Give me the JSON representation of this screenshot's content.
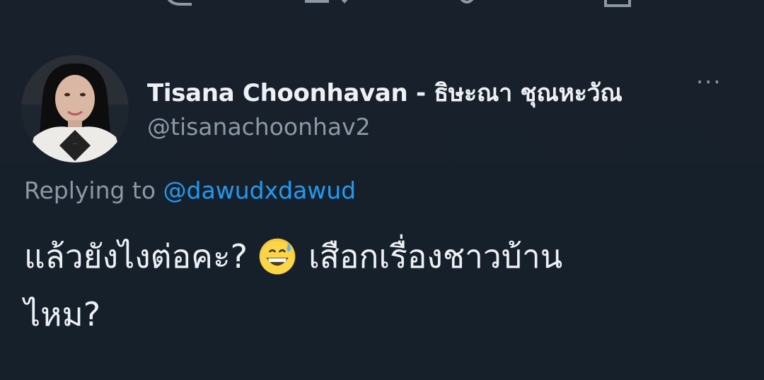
{
  "tweet": {
    "author_name": "Tisana Choonhavan - ธิษะณา ชุณหะวัณ",
    "handle": "@tisanachoonhav2",
    "more_symbol": "···",
    "replying_to_label": "Replying to",
    "replying_to_handle": "@dawudxdawud",
    "text_line1_a": "แล้วยังไงต่อคะ?",
    "emoji": "grinning-face-with-sweat-icon",
    "text_line1_b": "เสือกเรื่องชาวบ้าน",
    "text_line2": "ไหม?"
  },
  "colors": {
    "background": "#15202b",
    "primary_text": "#eef1f4",
    "secondary_text": "#8b98a5",
    "link": "#1d9bf0"
  },
  "icons": [
    "reply-icon",
    "retweet-icon",
    "like-icon",
    "share-icon",
    "more-icon"
  ]
}
